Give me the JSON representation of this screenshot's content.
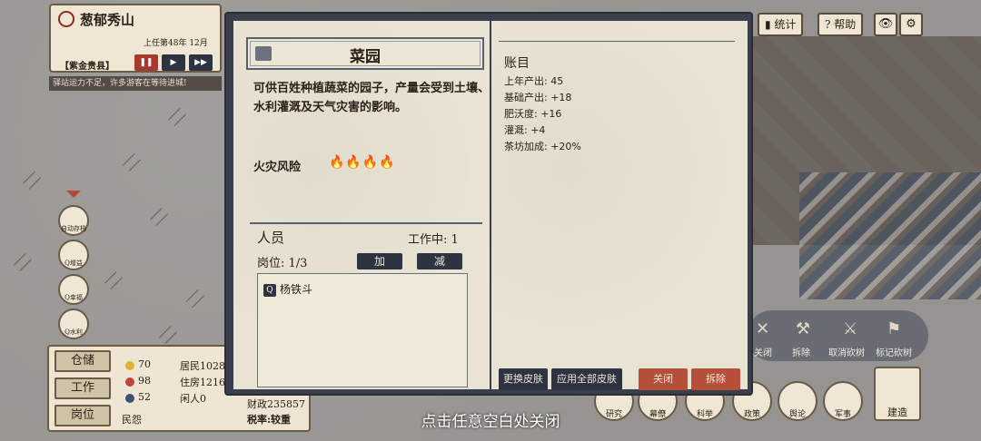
{
  "city": {
    "name": "葱郁秀山",
    "term": "上任第48年 12月",
    "rank": "【紫金贵县】",
    "notice": "驿站运力不足，许多游客在等待进城!"
  },
  "top_bar": {
    "stats_label": "统计",
    "help_label": "帮助",
    "eye_icon": "👁",
    "gear_icon": "⚙"
  },
  "side_icons": [
    "自动存档",
    "Q增益",
    "Q幸福",
    "Q水利"
  ],
  "stats": {
    "warehouse_label": "仓储",
    "work_label": "工作",
    "post_label": "岗位",
    "happy": "70",
    "heart": "98",
    "people": "52",
    "residents": "居民1028",
    "housing": "住房1216",
    "idle": "闲人0",
    "finance": "财政235857",
    "tax": "税率:较重",
    "grievance": "民怨"
  },
  "dialog": {
    "title": "菜园",
    "description": "可供百姓种植蔬菜的园子，产量会受到土壤、水利灌溉及天气灾害的影响。",
    "fire_risk_label": "火灾风险",
    "fire_icons": "🔥🔥🔥🔥",
    "staff_label": "人员",
    "working_label": "工作中: 1",
    "post_count_label": "岗位: 1/3",
    "add_label": "加",
    "remove_label": "减",
    "staff": [
      "杨铁斗"
    ],
    "ledger_title": "账目",
    "ledger": [
      "上年产出: 45",
      "基础产出: +18",
      "肥沃度: +16",
      "灌溉: +4",
      "茶坊加成: +20%"
    ],
    "change_skin_label": "更换皮肤",
    "apply_all_skin_label": "应用全部皮肤",
    "close_label": "关闭",
    "demolish_label": "拆除"
  },
  "tools": [
    "关闭",
    "拆除",
    "取消砍树",
    "标记砍树"
  ],
  "actions": [
    "研究",
    "幕僚",
    "科举",
    "政策",
    "舆论",
    "军事"
  ],
  "build_label": "建造",
  "close_hint": "点击任意空白处关闭"
}
